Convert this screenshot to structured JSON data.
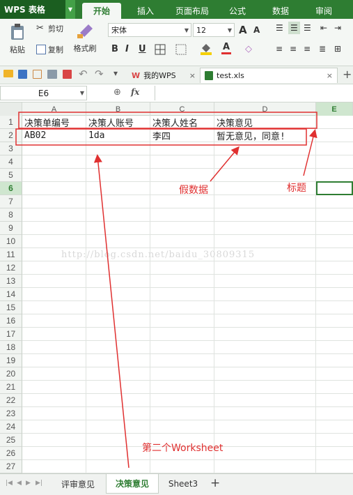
{
  "app": {
    "name": "WPS 表格"
  },
  "ribbon_tabs": [
    {
      "label": "开始",
      "active": true
    },
    {
      "label": "插入",
      "active": false
    },
    {
      "label": "页面布局",
      "active": false
    },
    {
      "label": "公式",
      "active": false
    },
    {
      "label": "数据",
      "active": false
    },
    {
      "label": "审阅",
      "active": false
    }
  ],
  "toolbar": {
    "paste": "粘贴",
    "cut": "剪切",
    "copy": "复制",
    "format_painter": "格式刷",
    "font_name": "宋体",
    "font_size": "12",
    "bold": "B",
    "italic": "I",
    "underline": "U",
    "grow_font": "A",
    "shrink_font": "A",
    "font_color_letter": "A"
  },
  "doc_tabs": [
    {
      "label": "我的WPS",
      "close": "×"
    },
    {
      "label": "test.xls",
      "close": "×"
    }
  ],
  "new_tab": "+",
  "formula_bar": {
    "name_box": "E6",
    "fx": "fx",
    "formula": ""
  },
  "columns": [
    "A",
    "B",
    "C",
    "D",
    "E"
  ],
  "selected_column": "E",
  "selected_row": "6",
  "rows": [
    "1",
    "2",
    "3",
    "4",
    "5",
    "6",
    "7",
    "8",
    "9",
    "10",
    "11",
    "12",
    "13",
    "14",
    "15",
    "16",
    "17",
    "18",
    "19",
    "20",
    "21",
    "22",
    "23",
    "24",
    "25",
    "26",
    "27"
  ],
  "cells": {
    "r1": [
      "决策单编号",
      "决策人账号",
      "决策人姓名",
      "决策意见"
    ],
    "r2": [
      "AB02",
      "1da",
      "李四",
      "暂无意见，同意!"
    ]
  },
  "watermark": "http://blog.csdn.net/baidu_30809315",
  "annotations": {
    "fake_data": "假数据",
    "header": "标题",
    "second_sheet": "第二个Worksheet"
  },
  "sheet_tabs": [
    {
      "label": "评审意见",
      "active": false
    },
    {
      "label": "决策意见",
      "active": true
    },
    {
      "label": "Sheet3",
      "active": false
    }
  ],
  "add_sheet": "+",
  "colors": {
    "accent": "#2e7d32",
    "annotation": "#e03030"
  }
}
